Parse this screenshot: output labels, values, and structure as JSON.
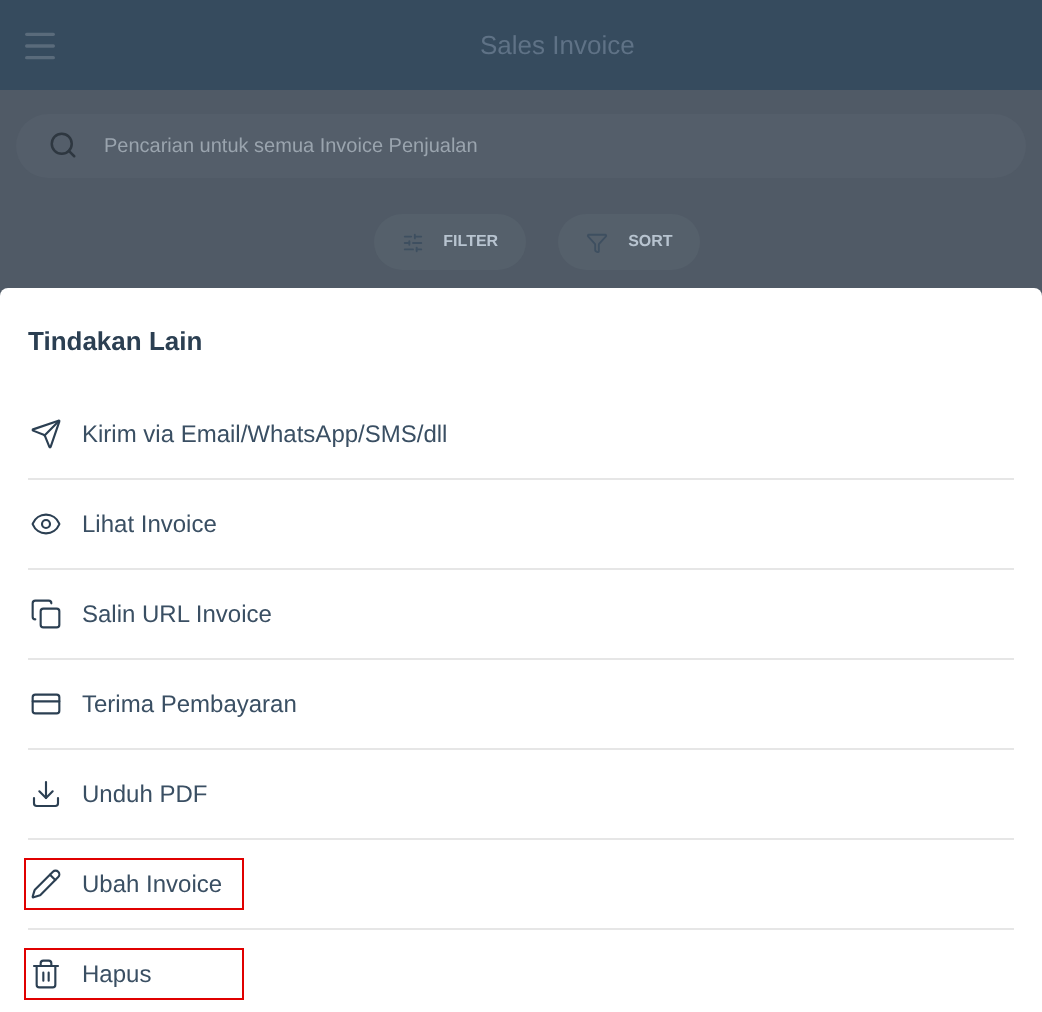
{
  "app_bar": {
    "title": "Sales Invoice"
  },
  "search": {
    "placeholder": "Pencarian untuk semua Invoice Penjualan"
  },
  "toolbar": [
    {
      "kind": "filter",
      "label": "FILTER"
    },
    {
      "kind": "sort",
      "label": "SORT"
    }
  ],
  "sheet": {
    "title": "Tindakan Lain",
    "actions": [
      {
        "kind": "send",
        "label": "Kirim via Email/WhatsApp/SMS/dll",
        "highlighted": false
      },
      {
        "kind": "view",
        "label": "Lihat Invoice",
        "highlighted": false
      },
      {
        "kind": "copy",
        "label": "Salin URL Invoice",
        "highlighted": false
      },
      {
        "kind": "payment",
        "label": "Terima Pembayaran",
        "highlighted": false
      },
      {
        "kind": "download",
        "label": "Unduh PDF",
        "highlighted": false
      },
      {
        "kind": "edit",
        "label": "Ubah Invoice",
        "highlighted": true
      },
      {
        "kind": "delete",
        "label": "Hapus",
        "highlighted": true
      }
    ]
  }
}
